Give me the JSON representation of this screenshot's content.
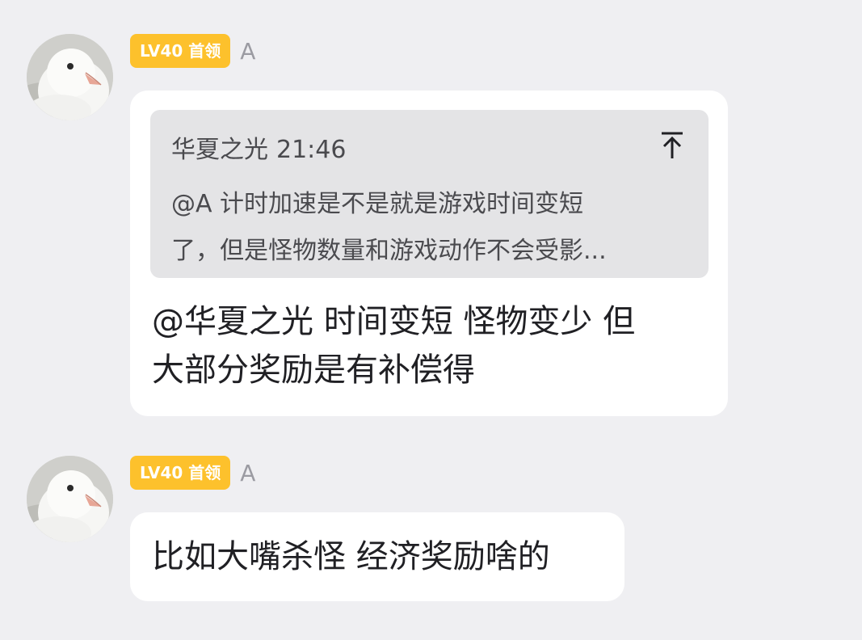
{
  "messages": [
    {
      "avatar_icon": "pigeon-avatar",
      "badge": "LV40 首领",
      "name": "A",
      "quote": {
        "author": "华夏之光",
        "time": "21:46",
        "lines": [
          "@A 计时加速是不是就是游戏时间变短",
          "了，但是怪物数量和游戏动作不会受影..."
        ],
        "pin_icon": "scroll-to-top-icon"
      },
      "text_lines": [
        "@华夏之光 时间变短 怪物变少 但",
        "大部分奖励是有补偿得"
      ]
    },
    {
      "avatar_icon": "pigeon-avatar",
      "badge": "LV40 首领",
      "name": "A",
      "text_lines": [
        "比如大嘴杀怪 经济奖励啥的"
      ]
    }
  ],
  "colors": {
    "background": "#efeff2",
    "bubble": "#ffffff",
    "quote_bg": "#e4e4e6",
    "badge": "#fdc12c",
    "name": "#9b9ba2"
  }
}
